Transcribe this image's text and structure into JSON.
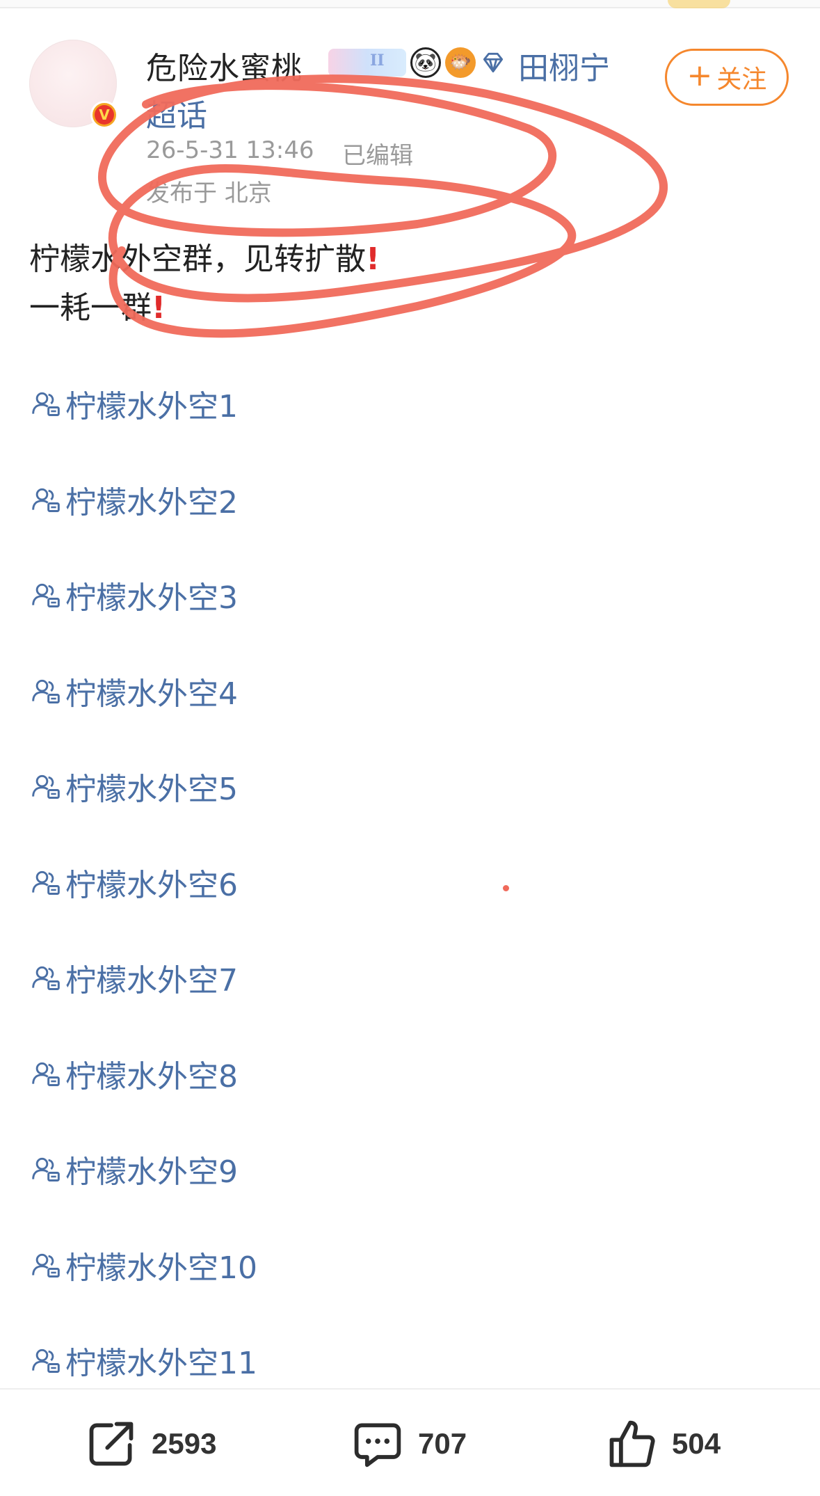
{
  "author": {
    "name": "危险水蜜桃",
    "verified_mark": "V",
    "badge_text": "II",
    "badge_icons": [
      "membership-badge",
      "panda-icon",
      "pufferfish-icon",
      "diamond-icon"
    ]
  },
  "topic": {
    "name": "田栩宁",
    "suffix": "超话"
  },
  "meta": {
    "time": "26-5-31 13:46",
    "edited": "已编辑",
    "location": "发布于 北京"
  },
  "follow_button": {
    "plus": "+",
    "label": "关注"
  },
  "post": {
    "line1": "柠檬水外空群，见转扩散",
    "line2": "一耗一群",
    "exclaim": "!"
  },
  "groups": [
    "柠檬水外空1",
    "柠檬水外空2",
    "柠檬水外空3",
    "柠檬水外空4",
    "柠檬水外空5",
    "柠檬水外空6",
    "柠檬水外空7",
    "柠檬水外空8",
    "柠檬水外空9",
    "柠檬水外空10",
    "柠檬水外空11"
  ],
  "actions": {
    "repost": "2593",
    "comment": "707",
    "like": "504"
  },
  "colors": {
    "link": "#4a6fa5",
    "follow": "#f5872d",
    "annotation": "#f06a5b",
    "alert": "#e02b2b"
  }
}
